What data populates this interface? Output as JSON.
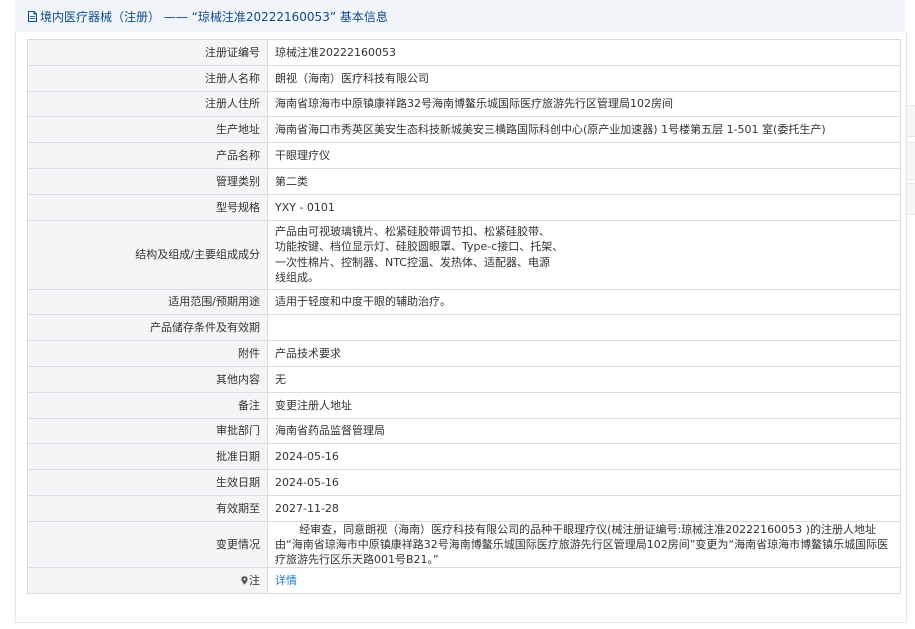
{
  "header": {
    "title": "境内医疗器械（注册） —— “琼械注准20222160053” 基本信息"
  },
  "rows": [
    {
      "label": "注册证编号",
      "value": "琼械注准20222160053"
    },
    {
      "label": "注册人名称",
      "value": "朗视（海南）医疗科技有限公司"
    },
    {
      "label": "注册人住所",
      "value": "海南省琼海市中原镇康祥路32号海南博鳌乐城国际医疗旅游先行区管理局102房间"
    },
    {
      "label": "生产地址",
      "value": "海南省海口市秀英区美安生态科技新城美安三横路国际科创中心(原产业加速器) 1号楼第五层 1-501 室(委托生产)"
    },
    {
      "label": "产品名称",
      "value": "干眼理疗仪"
    },
    {
      "label": "管理类别",
      "value": "第二类"
    },
    {
      "label": "型号规格",
      "value": "YXY - 0101"
    },
    {
      "label": "结构及组成/主要组成成分",
      "value_lines": [
        "产品由可视玻璃镜片、松紧硅胶带调节扣、松紧硅胶带、",
        "功能按键、档位显示灯、硅胶圆眼罩、Type-c接口、托架、",
        "一次性棉片、控制器、NTC控温、发热体、适配器、电源",
        "线组成。"
      ]
    },
    {
      "label": "适用范围/预期用途",
      "value": "适用于轻度和中度干眼的辅助治疗。"
    },
    {
      "label": "产品储存条件及有效期",
      "value": ""
    },
    {
      "label": "附件",
      "value": "产品技术要求"
    },
    {
      "label": "其他内容",
      "value": "无"
    },
    {
      "label": "备注",
      "value": "变更注册人地址"
    },
    {
      "label": "审批部门",
      "value": "海南省药品监督管理局"
    },
    {
      "label": "批准日期",
      "value": "2024-05-16"
    },
    {
      "label": "生效日期",
      "value": "2024-05-16"
    },
    {
      "label": "有效期至",
      "value": "2027-11-28"
    },
    {
      "label": "变更情况",
      "value": "经审查，同意朗视（海南）医疗科技有限公司的品种干眼理疗仪(械注册证编号:琼械注准20222160053 )的注册人地址由“海南省琼海市中原镇康祥路32号海南博鳌乐城国际医疗旅游先行区管理局102房间”变更为“海南省琼海市博鳌镇乐城国际医疗旅游先行区乐天路001号B21。”"
    }
  ],
  "note_row": {
    "label": "注",
    "link": "详情"
  },
  "colors": {
    "header_bg": "#f1f5f9",
    "header_text": "#0e4a8a",
    "label_bg": "#f4f5f7",
    "border": "#d9dde2",
    "link": "#1f7bd6"
  },
  "icons": {
    "header": "document-icon",
    "note": "map-pin-icon"
  }
}
